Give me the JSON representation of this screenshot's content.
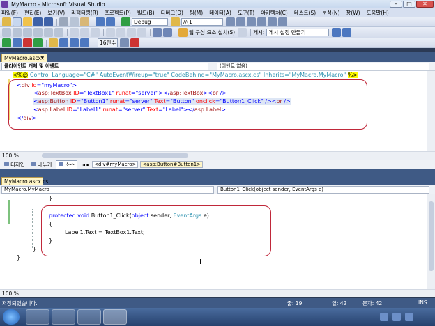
{
  "window": {
    "title": "MyMacro - Microsoft Visual Studio",
    "minimize": "–",
    "maximize": "□",
    "close": "✕"
  },
  "menu": [
    "파일(F)",
    "편집(E)",
    "보기(V)",
    "리팩터링(R)",
    "프로젝트(P)",
    "빌드(B)",
    "디버그(D)",
    "팀(M)",
    "데이터(A)",
    "도구(T)",
    "아키텍처(C)",
    "테스트(S)",
    "분석(N)",
    "창(W)",
    "도움말(H)"
  ],
  "toolbar": {
    "config": "Debug",
    "find": "//(1",
    "install_label": "웹 구성 요소 설치(S)",
    "publish_label": "게시:",
    "publish_combo": "게시 설정 만들기",
    "base_label": "16진수"
  },
  "editor1": {
    "tab": "MyMacro.ascx*",
    "nav_left": "클라이언트 개체 및 이벤트",
    "nav_right": "(이벤트 없음)",
    "line0": "<%@ Control Language=\"C#\" AutoEventWireup=\"true\" CodeBehind=\"MyMacro.ascx.cs\" Inherits=\"MyMacro.MyMacro\" %>",
    "zoom": "100 %",
    "view_design": "디자인",
    "view_split": "나누기",
    "view_source": "소스",
    "crumb1": "<div#myMacro>",
    "crumb2": "<asp:Button#Button1>"
  },
  "editor2": {
    "tab": "MyMacro.ascx.cs",
    "nav_left": "MyMacro.MyMacro",
    "nav_right": "Button1_Click(object sender, EventArgs e)",
    "zoom": "100 %"
  },
  "status": {
    "message": "저장되었습니다.",
    "line": "줄: 19",
    "col": "열: 42",
    "char": "문자: 42",
    "mode": "INS"
  }
}
